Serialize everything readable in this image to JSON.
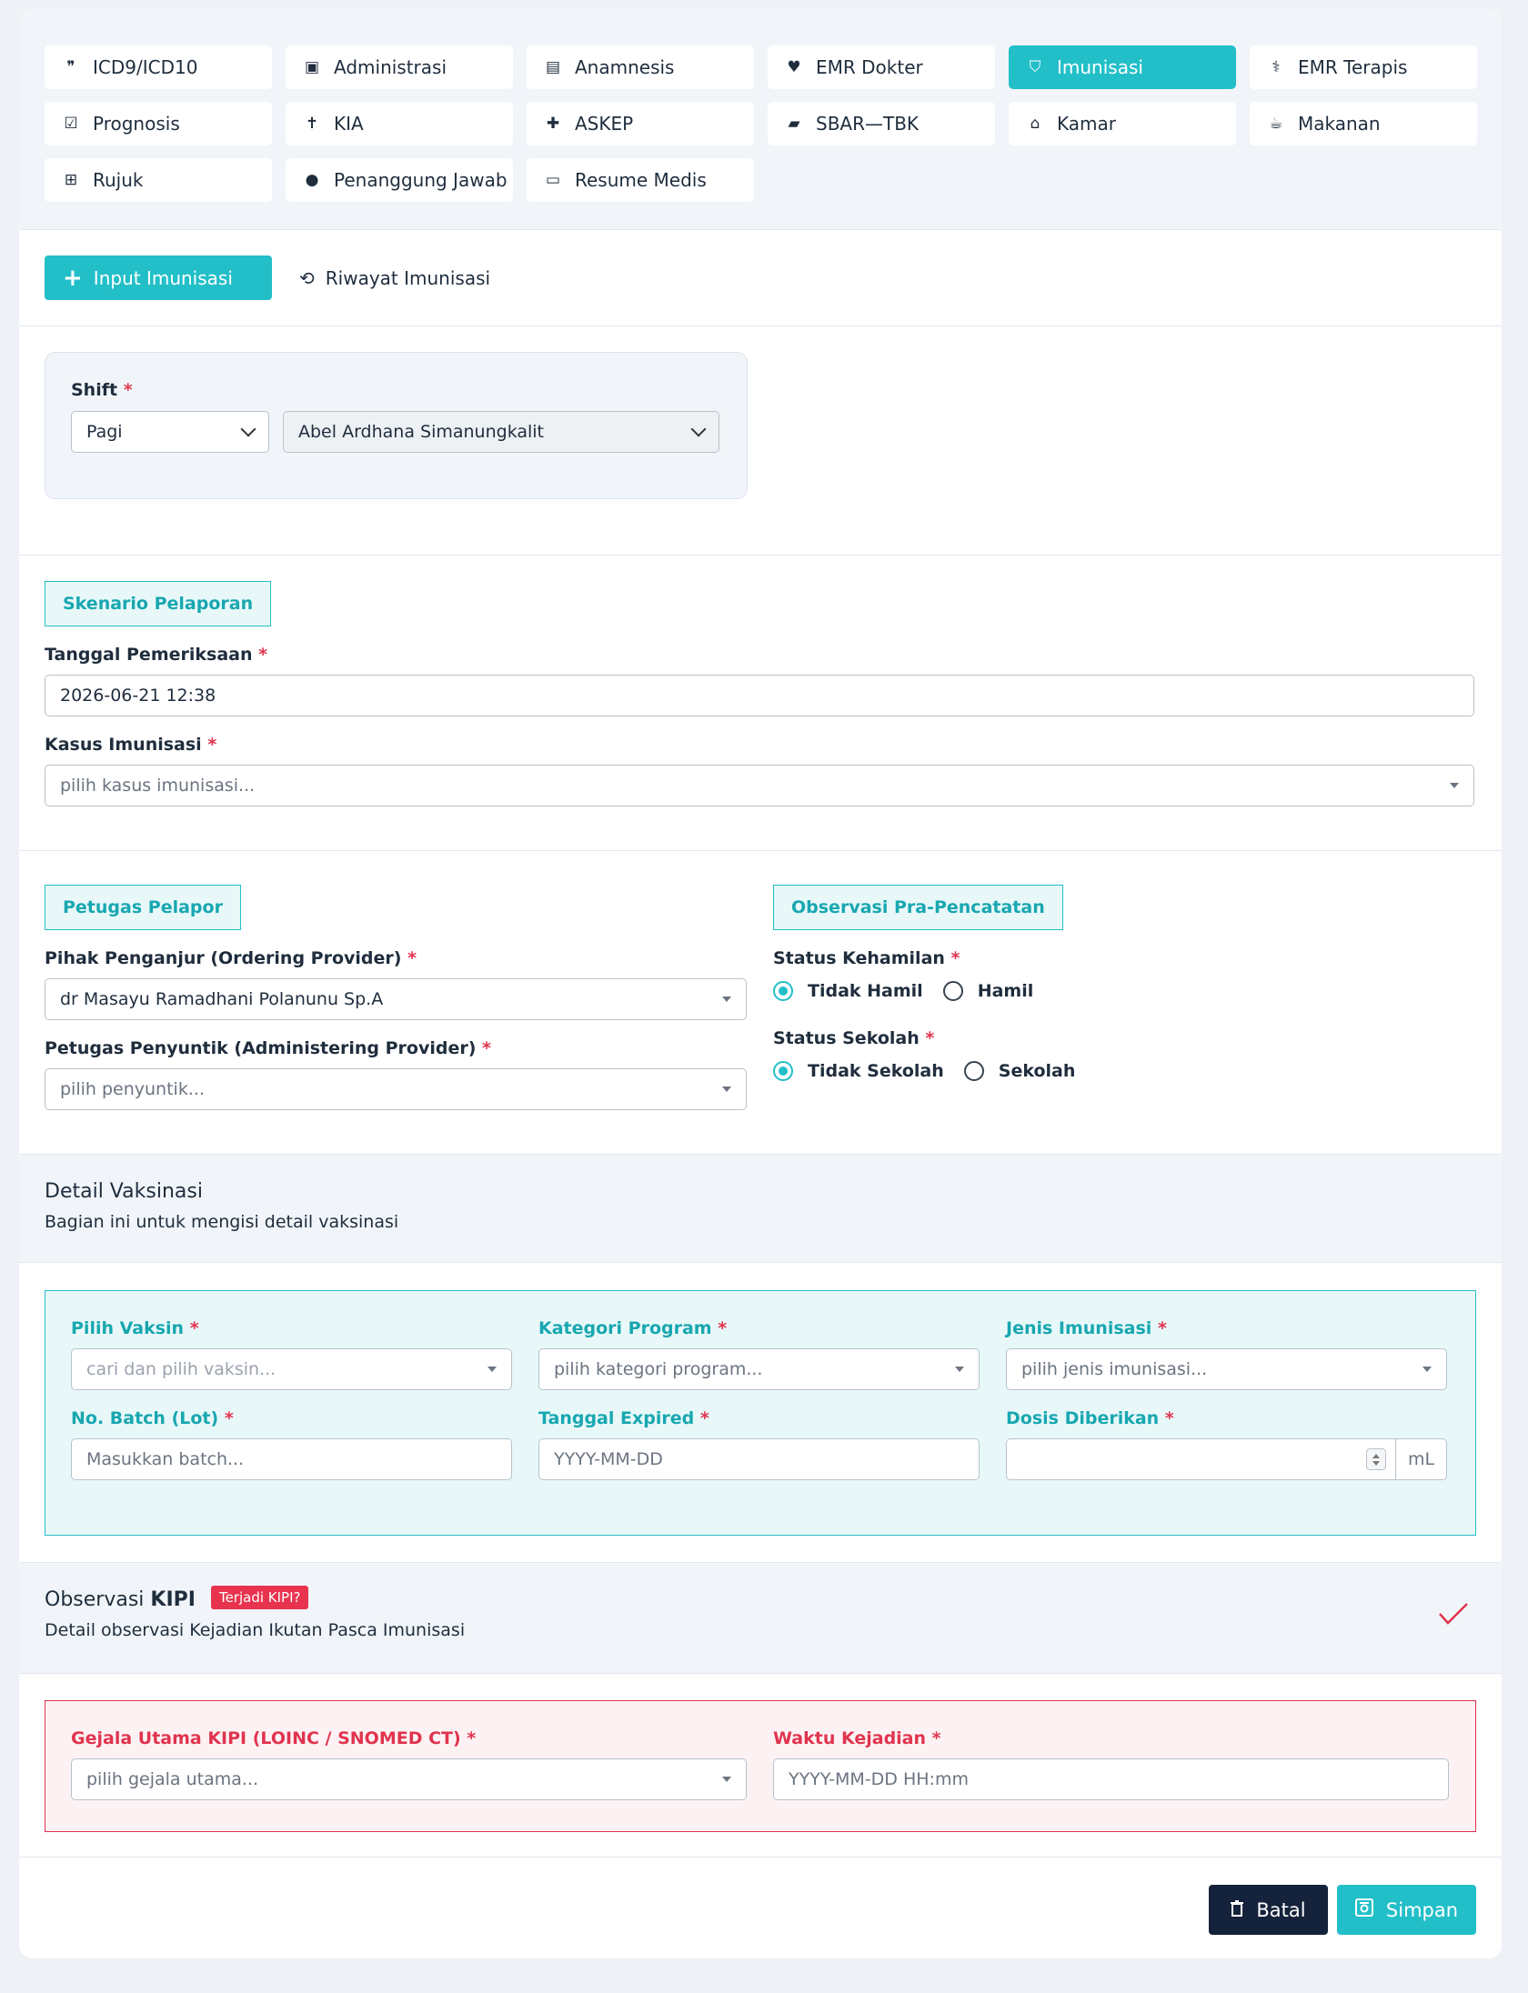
{
  "tabs": [
    {
      "label": "ICD9/ICD10",
      "icon": "quote-icon",
      "glyph": "❞",
      "active": false
    },
    {
      "label": "Administrasi",
      "icon": "copy-icon",
      "glyph": "▣",
      "active": false
    },
    {
      "label": "Anamnesis",
      "icon": "document-icon",
      "glyph": "▤",
      "active": false
    },
    {
      "label": "EMR Dokter",
      "icon": "heart-pulse-icon",
      "glyph": "♥",
      "active": false
    },
    {
      "label": "Imunisasi",
      "icon": "shield-icon",
      "glyph": "⛉",
      "active": true
    },
    {
      "label": "EMR Terapis",
      "icon": "user-doctor-icon",
      "glyph": "⚕",
      "active": false
    },
    {
      "label": "Prognosis",
      "icon": "check-square-icon",
      "glyph": "☑",
      "active": false
    },
    {
      "label": "KIA",
      "icon": "child-icon",
      "glyph": "✝",
      "active": false
    },
    {
      "label": "ASKEP",
      "icon": "medkit-icon",
      "glyph": "✚",
      "active": false
    },
    {
      "label": "SBAR—TBK",
      "icon": "folder-open-icon",
      "glyph": "▰",
      "active": false
    },
    {
      "label": "Kamar",
      "icon": "home-icon",
      "glyph": "⌂",
      "active": false
    },
    {
      "label": "Makanan",
      "icon": "coffee-icon",
      "glyph": "☕",
      "active": false
    },
    {
      "label": "Rujuk",
      "icon": "hospital-icon",
      "glyph": "⊞",
      "active": false
    },
    {
      "label": "Penanggung Jawab",
      "icon": "user-icon",
      "glyph": "●",
      "active": false
    },
    {
      "label": "Resume Medis",
      "icon": "id-card-icon",
      "glyph": "▭",
      "active": false
    }
  ],
  "subnav": {
    "input_label": "Input Imunisasi",
    "history_label": "Riwayat Imunisasi"
  },
  "shift": {
    "label": "Shift",
    "shift_value": "Pagi",
    "petugas_value": "Abel Ardhana Simanungkalit"
  },
  "skenario": {
    "badge": "Skenario Pelaporan",
    "tanggal_label": "Tanggal Pemeriksaan",
    "tanggal_value": "2026-06-21 12:38",
    "kasus_label": "Kasus Imunisasi",
    "kasus_placeholder": "pilih kasus imunisasi..."
  },
  "petugas": {
    "badge": "Petugas Pelapor",
    "ordering_label": "Pihak Penganjur (Ordering Provider)",
    "ordering_value": "dr Masayu Ramadhani Polanunu Sp.A",
    "administering_label": "Petugas Penyuntik (Administering Provider)",
    "administering_placeholder": "pilih penyuntik..."
  },
  "observasi": {
    "badge": "Observasi Pra-Pencatatan",
    "kehamilan_label": "Status Kehamilan",
    "kehamilan_options": [
      "Tidak Hamil",
      "Hamil"
    ],
    "kehamilan_selected": "Tidak Hamil",
    "sekolah_label": "Status Sekolah",
    "sekolah_options": [
      "Tidak Sekolah",
      "Sekolah"
    ],
    "sekolah_selected": "Tidak Sekolah"
  },
  "detail_vaksinasi": {
    "title": "Detail Vaksinasi",
    "subtitle": "Bagian ini untuk mengisi detail vaksinasi",
    "vaksin_label": "Pilih Vaksin",
    "vaksin_placeholder": "cari dan pilih vaksin...",
    "kategori_label": "Kategori Program",
    "kategori_placeholder": "pilih kategori program...",
    "jenis_label": "Jenis Imunisasi",
    "jenis_placeholder": "pilih jenis imunisasi...",
    "batch_label": "No. Batch (Lot)",
    "batch_placeholder": "Masukkan batch...",
    "expired_label": "Tanggal Expired",
    "expired_placeholder": "YYYY-MM-DD",
    "dosis_label": "Dosis Diberikan",
    "dosis_unit": "mL"
  },
  "kipi": {
    "title_prefix": "Observasi",
    "title_bold": "KIPI",
    "tag": "Terjadi KIPI?",
    "subtitle": "Detail observasi Kejadian Ikutan Pasca Imunisasi",
    "gejala_label": "Gejala Utama KIPI (LOINC / SNOMED CT)",
    "gejala_placeholder": "pilih gejala utama...",
    "waktu_label": "Waktu Kejadian",
    "waktu_placeholder": "YYYY-MM-DD HH:mm"
  },
  "footer": {
    "batal_label": "Batal",
    "simpan_label": "Simpan"
  },
  "colors": {
    "accent": "#22bfc8",
    "danger": "#e0344f",
    "dark": "#15223b"
  }
}
